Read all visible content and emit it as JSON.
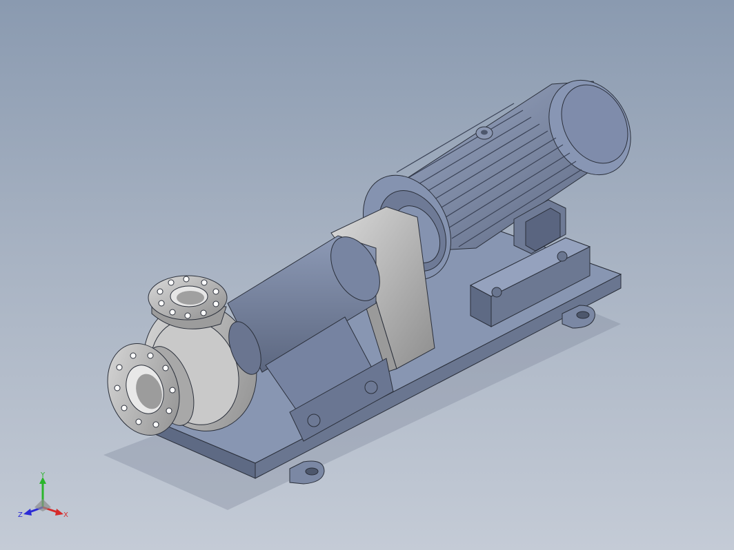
{
  "viewport": {
    "background_top": "#8a9ab0",
    "background_bottom": "#c4cbd6",
    "model_body_color": "#7f8ca8",
    "model_steel_color": "#b9b9b9"
  },
  "model": {
    "description_icons": [
      "pump-casing-icon",
      "motor-icon",
      "baseplate-icon",
      "coupling-guard-icon",
      "flange-icon"
    ]
  },
  "triad": {
    "y_label": "Y",
    "x_label": "X",
    "z_label": "Z",
    "y_color": "#2bb52b",
    "x_color": "#d62b2b",
    "z_color": "#2b2bd6"
  }
}
